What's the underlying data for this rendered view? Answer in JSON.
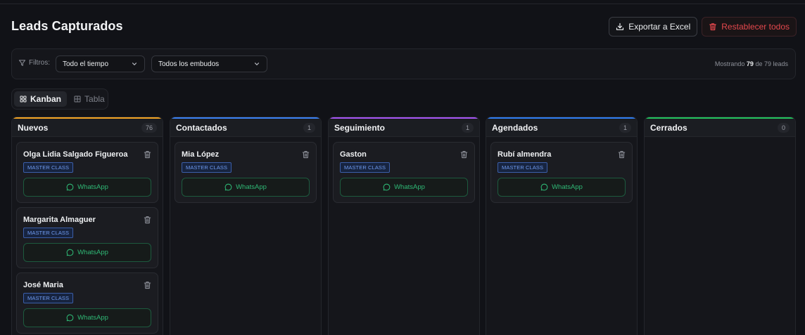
{
  "header": {
    "title": "Leads Capturados",
    "export_label": "Exportar a Excel",
    "reset_label": "Restablecer todos"
  },
  "filters": {
    "label": "Filtros:",
    "time_value": "Todo el tiempo",
    "funnel_value": "Todos los embudos",
    "showing_prefix": "Mostrando",
    "showing_count": "79",
    "showing_suffix": "de 79 leads"
  },
  "views": {
    "kanban_label": "Kanban",
    "table_label": "Tabla"
  },
  "columns": [
    {
      "title": "Nuevos",
      "count": "76",
      "accent": "#f5a524",
      "cards": [
        {
          "name": "Olga Lidia Salgado Figueroa",
          "tag": "MASTER CLASS",
          "action": "WhatsApp"
        },
        {
          "name": "Margarita Almaguer",
          "tag": "MASTER CLASS",
          "action": "WhatsApp"
        },
        {
          "name": "José Maria",
          "tag": "MASTER CLASS",
          "action": "WhatsApp"
        }
      ]
    },
    {
      "title": "Contactados",
      "count": "1",
      "accent": "#3b82f6",
      "cards": [
        {
          "name": "Mia López",
          "tag": "MASTER CLASS",
          "action": "WhatsApp"
        }
      ]
    },
    {
      "title": "Seguimiento",
      "count": "1",
      "accent": "#a855f7",
      "cards": [
        {
          "name": "Gaston",
          "tag": "MASTER CLASS",
          "action": "WhatsApp"
        }
      ]
    },
    {
      "title": "Agendados",
      "count": "1",
      "accent": "#2f7ef5",
      "cards": [
        {
          "name": "Rubí almendra",
          "tag": "MASTER CLASS",
          "action": "WhatsApp"
        }
      ]
    },
    {
      "title": "Cerrados",
      "count": "0",
      "accent": "#22c55e",
      "cards": []
    }
  ],
  "colors": {
    "background": "#111217",
    "danger": "#e5484d",
    "whatsapp": "#2fb875",
    "tag": "#6f9bf0"
  }
}
